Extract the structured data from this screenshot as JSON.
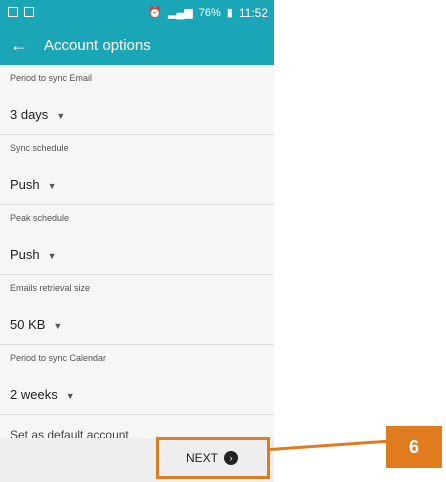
{
  "status_bar": {
    "battery": "76%",
    "time": "11:52"
  },
  "app_bar": {
    "back_icon": "arrow-left-icon",
    "title": "Account options"
  },
  "settings": [
    {
      "label": "Period to sync Email",
      "value": "3 days"
    },
    {
      "label": "Sync schedule",
      "value": "Push"
    },
    {
      "label": "Peak schedule",
      "value": "Push"
    },
    {
      "label": "Emails retrieval size",
      "value": "50 KB"
    },
    {
      "label": "Period to sync Calendar",
      "value": "2 weeks"
    }
  ],
  "partial_item": "Set as default account",
  "bottom_bar": {
    "next_label": "NEXT"
  },
  "annotation": {
    "step": "6"
  },
  "colors": {
    "accent": "#1ba6b7",
    "callout": "#e07b1e"
  }
}
